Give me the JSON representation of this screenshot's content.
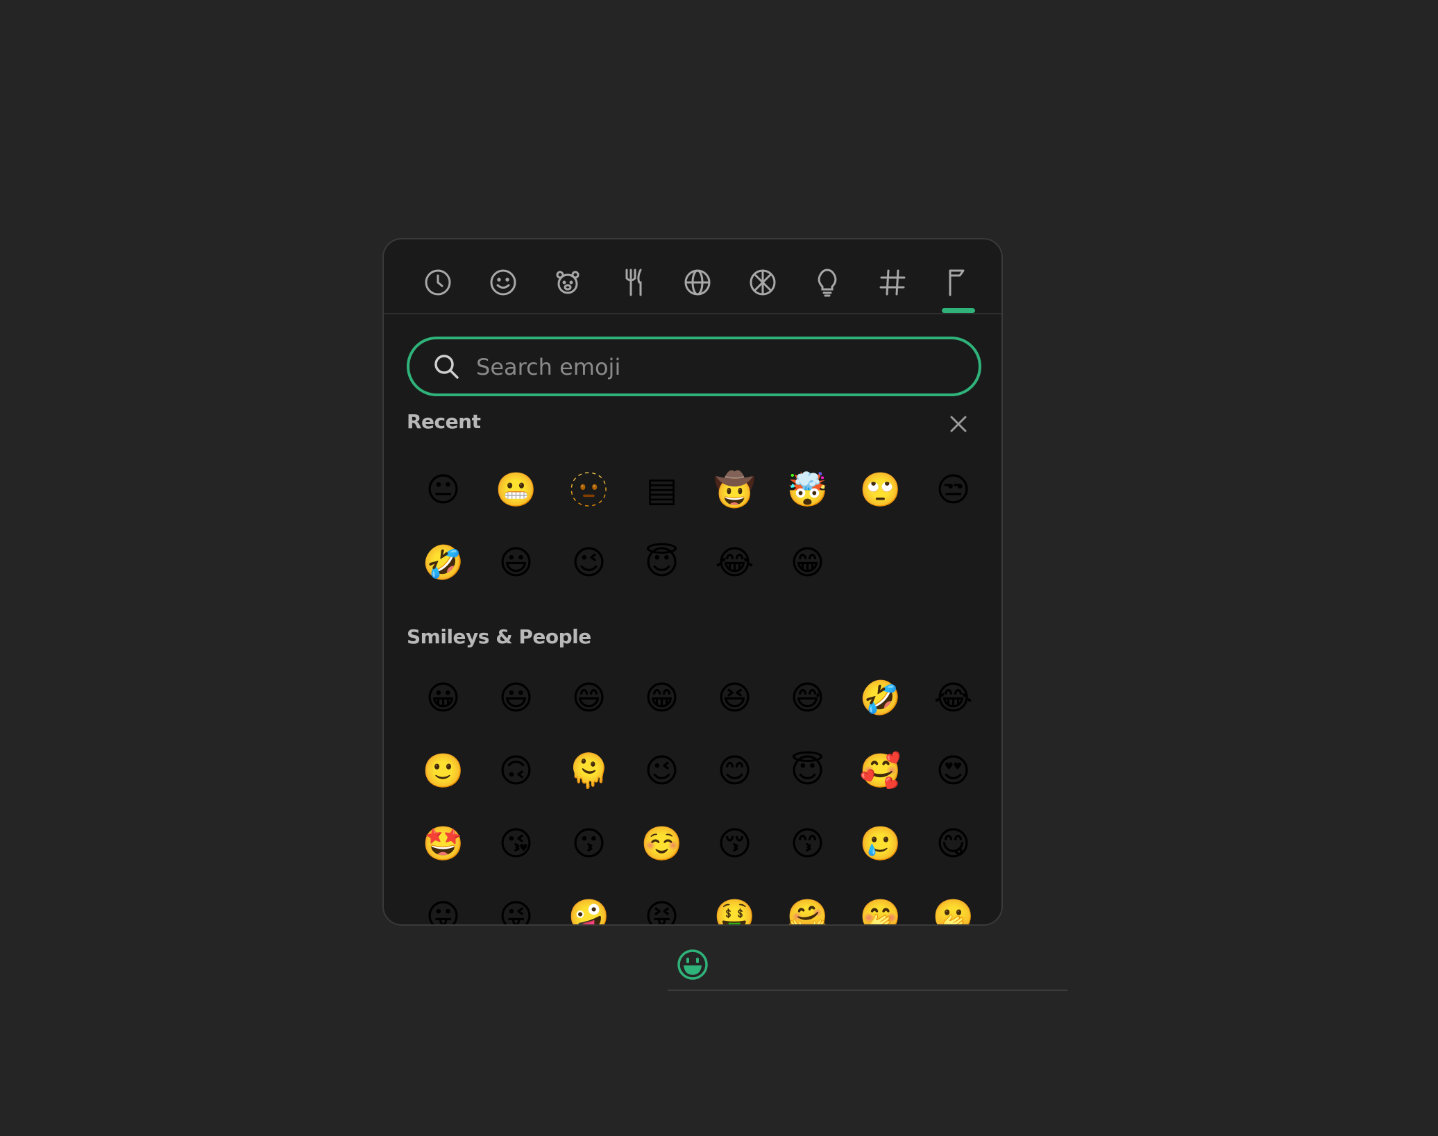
{
  "tabs": [
    {
      "name": "tab-recent",
      "icon": "clock-icon"
    },
    {
      "name": "tab-smileys",
      "icon": "smiley-icon"
    },
    {
      "name": "tab-animals",
      "icon": "bear-icon"
    },
    {
      "name": "tab-food",
      "icon": "fork-knife-icon"
    },
    {
      "name": "tab-travel",
      "icon": "globe-icon"
    },
    {
      "name": "tab-activities",
      "icon": "ball-icon"
    },
    {
      "name": "tab-objects",
      "icon": "lightbulb-icon"
    },
    {
      "name": "tab-symbols",
      "icon": "hash-icon"
    },
    {
      "name": "tab-flags",
      "icon": "flag-icon",
      "active": true
    }
  ],
  "accent_color": "#2fb37a",
  "search": {
    "placeholder": "Search emoji",
    "value": ""
  },
  "recent": {
    "title": "Recent",
    "emojis": [
      "😐",
      "😬",
      "🫥",
      "▤",
      "🤠",
      "🤯",
      "🙄",
      "😒",
      "🤣",
      "😃",
      "😉",
      "😇",
      "😂",
      "😁"
    ]
  },
  "smileys": {
    "title": "Smileys & People",
    "emojis": [
      "😀",
      "😃",
      "😄",
      "😁",
      "😆",
      "😅",
      "🤣",
      "😂",
      "🙂",
      "🙃",
      "🫠",
      "😉",
      "😊",
      "😇",
      "🥰",
      "😍",
      "🤩",
      "😘",
      "😗",
      "☺️",
      "😚",
      "😙",
      "🥲",
      "😋",
      "😛",
      "😜",
      "🤪",
      "😝",
      "🤑",
      "🤗",
      "🤭",
      "🫢"
    ]
  }
}
